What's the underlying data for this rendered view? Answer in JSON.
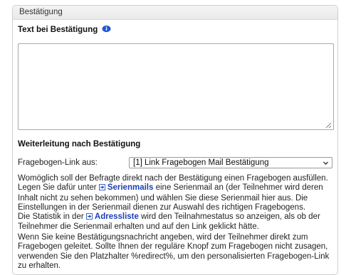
{
  "panel": {
    "title": "Bestätigung"
  },
  "confirmation": {
    "label": "Text bei Bestätigung",
    "text_value": ""
  },
  "redirect": {
    "title": "Weiterleitung nach Bestätigung",
    "link_label": "Fragebogen-Link aus:",
    "link_selected": "[1] Link Fragebogen Mail Bestätigung"
  },
  "paragraphs": {
    "p1_a": "Womöglich soll der Befragte direkt nach der Bestätigung einen Fragebogen ausfüllen. Legen Sie dafür unter",
    "p1_link": "Serienmails",
    "p1_b": "eine Serienmail an (der Teilnehmer wird deren Inhalt nicht zu sehen bekommen) und wählen Sie diese Serienmail hier aus. Die Einstellungen in der Serienmail dienen zur Auswahl des richtigen Fragebogens.",
    "p2_a": "Die Statistik in der",
    "p2_link": "Adressliste",
    "p2_b": "wird den Teilnahmestatus so anzeigen, als ob der Teilnehmer die Serienmail erhalten und auf den Link geklickt hätte.",
    "p3": "Wenn Sie keine Bestätigungsnachricht angeben, wird der Teilnehmer direkt zum Fragebogen geleitet. Sollte Ihnen der reguläre Knopf zum Fragebogen nicht zusagen, verwenden Sie den Platzhalter %redirect%, um den personalisierten Fragebogen-Link zu erhalten."
  },
  "icons": {
    "info": "info-icon",
    "link_arrow": "arrow-link-icon",
    "dropdown": "chevron-down-icon",
    "resize": "resize-grip-icon"
  },
  "colors": {
    "link": "#1a3fb8",
    "info_icon": "#2456d6",
    "header_bg": "#ececec",
    "border": "#cfcfcf"
  }
}
